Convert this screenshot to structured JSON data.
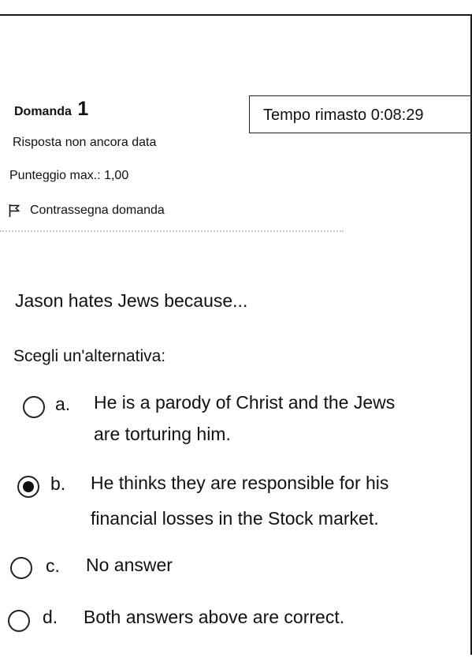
{
  "question": {
    "label": "Domanda",
    "number": "1",
    "status": "Risposta non ancora data",
    "max_score": "Punteggio max.: 1,00",
    "flag_label": "Contrassegna domanda",
    "text": "Jason hates Jews because...",
    "instruction": "Scegli un'alternativa:"
  },
  "timer": {
    "text": "Tempo rimasto 0:08:29"
  },
  "options": [
    {
      "letter": "a.",
      "line1": "He is a parody of Christ and the Jews",
      "line2": "are torturing him.",
      "selected": false
    },
    {
      "letter": "b.",
      "line1": "He thinks they are responsible for his",
      "line2": "financial losses in the Stock market.",
      "selected": true
    },
    {
      "letter": "c.",
      "line1": "No answer",
      "selected": false
    },
    {
      "letter": "d.",
      "line1": "Both answers above are correct.",
      "selected": false
    }
  ],
  "icons": {
    "flag": "flag-icon",
    "radio": "radio-icon"
  },
  "colors": {
    "text": "#111111",
    "border": "#222222",
    "separator": "#c8c8c8",
    "background": "#ffffff"
  }
}
